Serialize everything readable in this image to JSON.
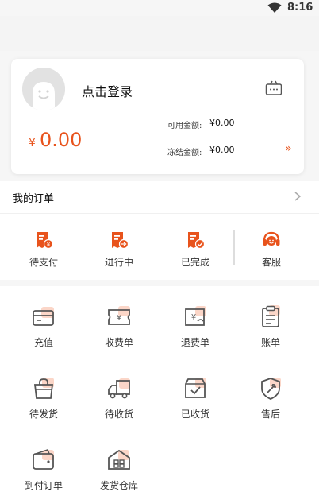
{
  "status_bar": {
    "time": "8:16",
    "wifi_icon": "wifi-icon"
  },
  "profile": {
    "login_label": "点击登录",
    "balance_currency": "¥",
    "balance": "0.00",
    "available_label": "可用金额:",
    "available_value": "¥0.00",
    "frozen_label": "冻结金额:",
    "frozen_value": "¥0.00",
    "more_icon": "double-chevron-right-icon"
  },
  "orders": {
    "title": "我的订单",
    "items": [
      {
        "label": "待支付",
        "icon": "pending-payment-icon"
      },
      {
        "label": "进行中",
        "icon": "in-progress-icon"
      },
      {
        "label": "已完成",
        "icon": "completed-icon"
      },
      {
        "label": "客服",
        "icon": "customer-service-icon"
      }
    ]
  },
  "services": {
    "items": [
      {
        "label": "充值",
        "icon": "card-icon"
      },
      {
        "label": "收费单",
        "icon": "ticket-icon"
      },
      {
        "label": "退费单",
        "icon": "refund-icon"
      },
      {
        "label": "账单",
        "icon": "clipboard-icon"
      },
      {
        "label": "待发货",
        "icon": "shopping-bag-icon"
      },
      {
        "label": "待收货",
        "icon": "truck-icon"
      },
      {
        "label": "已收货",
        "icon": "box-check-icon"
      },
      {
        "label": "售后",
        "icon": "wrench-shield-icon"
      },
      {
        "label": "到付订单",
        "icon": "wallet-icon"
      },
      {
        "label": "发货仓库",
        "icon": "warehouse-icon"
      }
    ]
  },
  "colors": {
    "accent": "#e8531c",
    "icon_gray": "#555555",
    "icon_highlight": "#fbd6c8"
  }
}
